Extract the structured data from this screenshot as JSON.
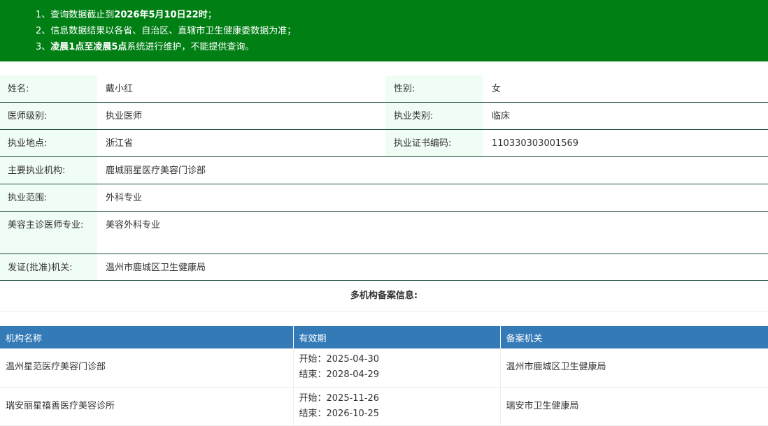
{
  "notice": {
    "line1_plain": "1、查询数据截止到",
    "line1_bold": "2026年5月10日22时",
    "line1_end": "；",
    "line2": "2、信息数据结果以各省、自治区、直辖市卫生健康委数据为准；",
    "line3_prefix": "3、",
    "line3_bold": "凌晨1点至凌晨5点",
    "line3_end": "系统进行维护，不能提供查询。"
  },
  "info": {
    "name_label": "姓名:",
    "name": "戴小红",
    "gender_label": "性别:",
    "gender": "女",
    "level_label": "医师级别:",
    "level": "执业医师",
    "category_label": "执业类别:",
    "category": "临床",
    "location_label": "执业地点:",
    "location": "浙江省",
    "cert_label": "执业证书编码:",
    "cert": "110330303001569",
    "institution_label": "主要执业机构:",
    "institution": "鹿城丽星医疗美容门诊部",
    "scope_label": "执业范围:",
    "scope": "外科专业",
    "cosmetic_label": "美容主诊医师专业:",
    "cosmetic": "美容外科专业",
    "issuer_label": "发证(批准)机关:",
    "issuer": "温州市鹿城区卫生健康局"
  },
  "multi_title": "多机构备案信息:",
  "registration": {
    "headers": [
      "机构名称",
      "有效期",
      "备案机关"
    ],
    "rows": [
      {
        "org": "温州星范医疗美容门诊部",
        "start": "开始：2025-04-30",
        "end": "结束：2028-04-29",
        "authority": "温州市鹿城区卫生健康局"
      },
      {
        "org": "瑞安丽星禧善医疗美容诊所",
        "start": "开始：2025-11-26",
        "end": "结束：2026-10-25",
        "authority": "瑞安市卫生健康局"
      }
    ]
  }
}
